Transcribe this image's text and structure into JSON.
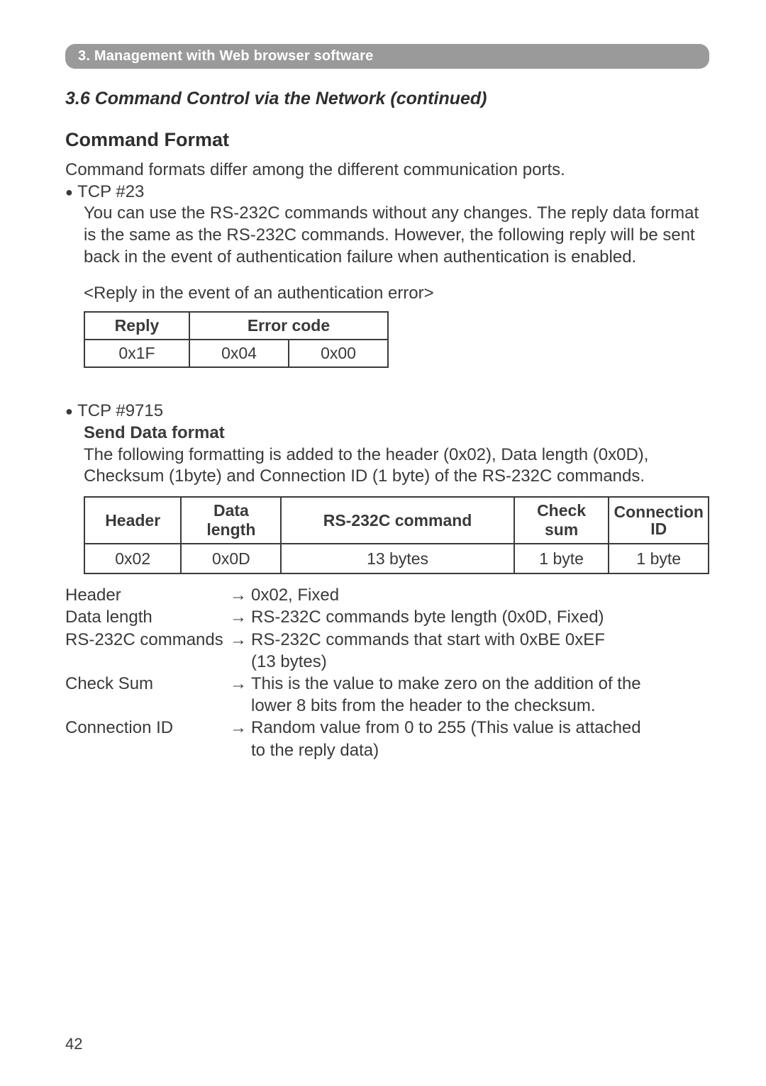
{
  "breadcrumb": "3. Management with Web browser software",
  "section_title": "3.6 Command Control via the Network (continued)",
  "h_command_format": "Command Format",
  "intro_line": "Command formats differ among the different communication ports.",
  "tcp23_label": "TCP #23",
  "tcp23_body": "You can use the RS-232C commands without any changes. The reply data format is the same as the RS-232C commands. However, the following reply will be sent back in the event of authentication failure when authentication is enabled.",
  "auth_error_caption": "<Reply in the event of an authentication error>",
  "tbl_auth": {
    "h_reply": "Reply",
    "h_error": "Error code",
    "v_reply": "0x1F",
    "v_err1": "0x04",
    "v_err2": "0x00"
  },
  "tcp9715_label": "TCP #9715",
  "send_data_heading": "Send Data format",
  "send_data_body": "The following formatting is added to the header (0x02), Data length (0x0D), Checksum (1byte) and Connection ID (1 byte) of the RS-232C commands.",
  "tbl_send": {
    "h1": "Header",
    "h2": "Data length",
    "h3": "RS-232C command",
    "h4": "Check sum",
    "h5a": "Connection",
    "h5b": "ID",
    "v1": "0x02",
    "v2": "0x0D",
    "v3": "13 bytes",
    "v4": "1 byte",
    "v5": "1 byte"
  },
  "defs": {
    "arrow": "→",
    "t1": "Header",
    "d1": "0x02, Fixed",
    "t2": "Data length",
    "d2": "RS-232C commands byte length (0x0D, Fixed)",
    "t3": "RS-232C commands",
    "d3a": "RS-232C commands that start with 0xBE 0xEF",
    "d3b": "(13 bytes)",
    "t4": "Check Sum",
    "d4a": "This is the value to make zero on the addition of the",
    "d4b": "lower 8 bits from the header to the checksum.",
    "t5": "Connection ID",
    "d5a": "Random value from 0 to 255 (This value is attached",
    "d5b": "to the reply data)"
  },
  "page_number": "42"
}
